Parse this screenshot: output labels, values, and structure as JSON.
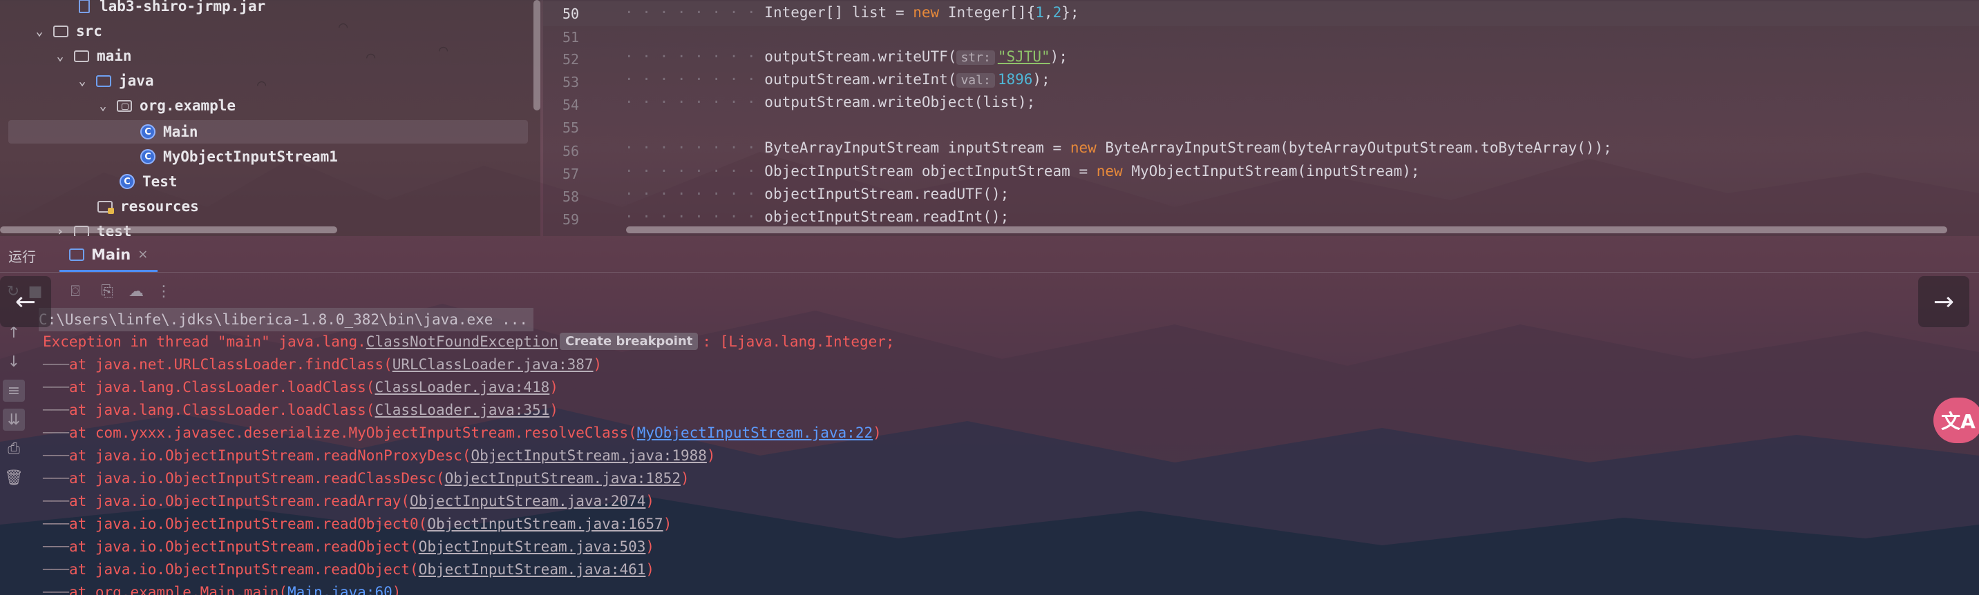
{
  "project_tree": {
    "items": [
      {
        "label": "lab3-shiro-jrmp.jar",
        "type": "jar",
        "expanded": null
      },
      {
        "label": "src",
        "type": "folder",
        "expanded": true
      },
      {
        "label": "main",
        "type": "folder",
        "expanded": true
      },
      {
        "label": "java",
        "type": "source-folder",
        "expanded": true
      },
      {
        "label": "org.example",
        "type": "package",
        "expanded": true
      },
      {
        "label": "Main",
        "type": "class",
        "selected": true
      },
      {
        "label": "MyObjectInputStream1",
        "type": "class"
      },
      {
        "label": "Test",
        "type": "class"
      },
      {
        "label": "resources",
        "type": "resources-folder"
      },
      {
        "label": "test",
        "type": "folder",
        "expanded": false
      }
    ]
  },
  "editor": {
    "lines": [
      {
        "num": "50",
        "current": true
      },
      {
        "num": "51"
      },
      {
        "num": "52"
      },
      {
        "num": "53"
      },
      {
        "num": "54"
      },
      {
        "num": "55"
      },
      {
        "num": "56"
      },
      {
        "num": "57"
      },
      {
        "num": "58"
      },
      {
        "num": "59"
      }
    ],
    "code": {
      "l50_a": "Integer[] list = ",
      "l50_kw": "new",
      "l50_b": " Integer[]{",
      "l50_n1": "1",
      "l50_comma": ",",
      "l50_n2": "2",
      "l50_c": "};",
      "l52_a": "outputStream.writeUTF(",
      "l52_hint": "str:",
      "l52_str": "\"SJTU\"",
      "l52_b": ");",
      "l53_a": "outputStream.writeInt(",
      "l53_hint": "val:",
      "l53_num": "1896",
      "l53_b": ");",
      "l54": "outputStream.writeObject(list);",
      "l56_a": "ByteArrayInputStream inputStream = ",
      "l56_kw": "new",
      "l56_b": " ByteArrayInputStream(byteArrayOutputStream.toByteArray());",
      "l57_a": "ObjectInputStream objectInputStream = ",
      "l57_kw": "new",
      "l57_b": " MyObjectInputStream(inputStream);",
      "l58": "objectInputStream.readUTF();",
      "l59": "objectInputStream.readInt();",
      "indent_dots": "· · · · · · · · "
    }
  },
  "run_panel": {
    "title": "运行",
    "tab_label": "Main",
    "tab_close": "×"
  },
  "console": {
    "command": "C:\\Users\\linfe\\.jdks\\liberica-1.8.0_382\\bin\\java.exe ...",
    "exception_prefix": "Exception in thread \"main\" java.lang.",
    "exception_class": "ClassNotFoundException",
    "breakpoint_label": "Create breakpoint",
    "exception_suffix": ": [Ljava.lang.Integer;",
    "dash": "───",
    "frames": [
      {
        "method": "at java.net.URLClassLoader.findClass(",
        "loc": "URLClassLoader.java:387",
        "highlight": false
      },
      {
        "method": "at java.lang.ClassLoader.loadClass(",
        "loc": "ClassLoader.java:418",
        "highlight": false
      },
      {
        "method": "at java.lang.ClassLoader.loadClass(",
        "loc": "ClassLoader.java:351",
        "highlight": false
      },
      {
        "method": "at com.yxxx.javasec.deserialize.MyObjectInputStream.resolveClass(",
        "loc": "MyObjectInputStream.java:22",
        "highlight": true
      },
      {
        "method": "at java.io.ObjectInputStream.readNonProxyDesc(",
        "loc": "ObjectInputStream.java:1988",
        "highlight": false
      },
      {
        "method": "at java.io.ObjectInputStream.readClassDesc(",
        "loc": "ObjectInputStream.java:1852",
        "highlight": false
      },
      {
        "method": "at java.io.ObjectInputStream.readArray(",
        "loc": "ObjectInputStream.java:2074",
        "highlight": false
      },
      {
        "method": "at java.io.ObjectInputStream.readObject0(",
        "loc": "ObjectInputStream.java:1657",
        "highlight": false
      },
      {
        "method": "at java.io.ObjectInputStream.readObject(",
        "loc": "ObjectInputStream.java:503",
        "highlight": false
      },
      {
        "method": "at java.io.ObjectInputStream.readObject(",
        "loc": "ObjectInputStream.java:461",
        "highlight": false
      },
      {
        "method": "at org.example.Main.main(",
        "loc": "Main.java:60",
        "highlight": true
      }
    ],
    "close_paren": ")"
  },
  "overlay": {
    "prev_icon": "←",
    "next_icon": "→",
    "translate_icon": "文A"
  },
  "colors": {
    "error": "#ef5a5a",
    "keyword": "#e7893a",
    "number": "#4fb8d8",
    "string": "#8fc36a",
    "link_blue": "#5c9bff",
    "tab_underline": "#4f8df5",
    "translate_button": "#e05a7e"
  }
}
